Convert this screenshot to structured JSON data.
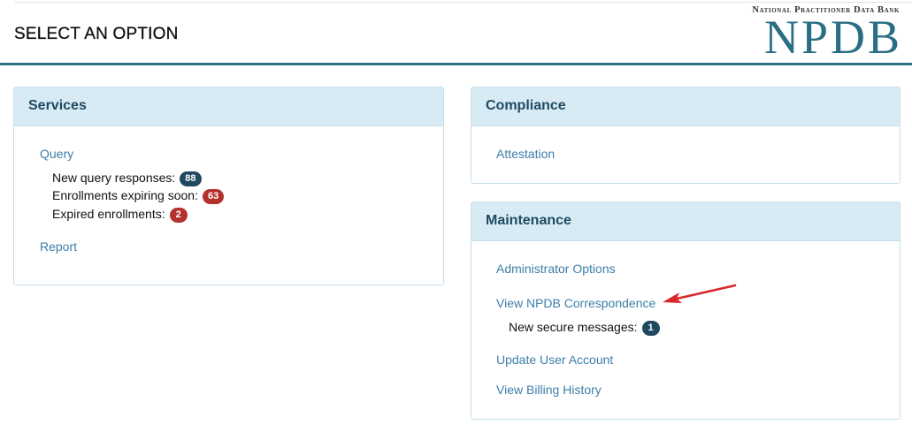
{
  "header": {
    "title": "SELECT AN OPTION",
    "brand_tagline": "National Practitioner Data Bank",
    "brand_logo": "NPDB"
  },
  "services": {
    "title": "Services",
    "query_link": "Query",
    "stats": [
      {
        "label": "New query responses:",
        "count": "88"
      },
      {
        "label": "Enrollments expiring soon:",
        "count": "63"
      },
      {
        "label": "Expired enrollments:",
        "count": "2"
      }
    ],
    "report_link": "Report"
  },
  "compliance": {
    "title": "Compliance",
    "attestation_link": "Attestation"
  },
  "maintenance": {
    "title": "Maintenance",
    "admin_options_link": "Administrator Options",
    "correspondence_link": "View NPDB Correspondence",
    "secure_messages_label": "New secure messages:",
    "secure_messages_count": "1",
    "update_account_link": "Update User Account",
    "billing_history_link": "View Billing History"
  },
  "colors": {
    "accent": "#2a7186",
    "panel_header": "#d8ebf5",
    "link": "#3d7eaa",
    "badge_navy": "#1f4960",
    "badge_red": "#b5312e",
    "annotation_arrow": "#d9262b"
  },
  "icons": {
    "annotation": "red-pointer-arrow-icon"
  }
}
